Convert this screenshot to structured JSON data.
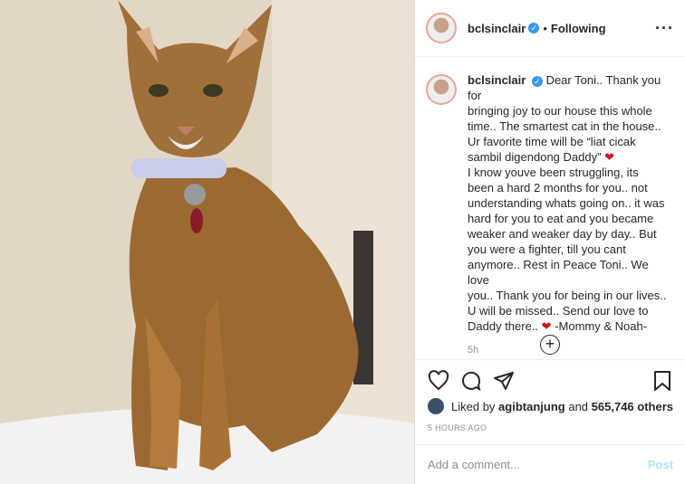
{
  "post": {
    "username": "bclsinclair",
    "follow_status": "Following",
    "caption_lines": [
      "Dear Toni.. Thank you for",
      "bringing joy to our house this whole",
      "time.. The smartest cat in the house..",
      "Ur favorite time will be “liat cicak",
      "sambil digendong Daddy”",
      "I know youve been struggling, its",
      "been a hard 2 months for you.. not",
      "understanding whats going on.. it was",
      "hard for you to eat and you became",
      "weaker and weaker day by day.. But",
      "you were a fighter, till you cant",
      "anymore.. Rest in Peace Toni.. We love",
      "you.. Thank you for being in our lives..",
      "U will be missed.. Send our love to",
      "Daddy there.."
    ],
    "caption_sign": "-Mommy & Noah-",
    "caption_time": "5h",
    "liked_by_prefix": "Liked by",
    "liked_by_user": "agibtanjung",
    "liked_by_and": "and",
    "likes_count": "565,746 others",
    "timestamp": "5 HOURS AGO",
    "comment_placeholder": "Add a comment...",
    "post_label": "Post"
  },
  "icons": {
    "more": "more-options-icon",
    "heart": "heart-icon",
    "comment": "comment-icon",
    "share": "share-icon",
    "save": "bookmark-icon",
    "load_more": "plus-circle-icon",
    "verified": "verified-badge-icon"
  },
  "colors": {
    "verified": "#3897f0",
    "heart_emoji": "#d1111d",
    "post_button": "#b2dffc"
  }
}
